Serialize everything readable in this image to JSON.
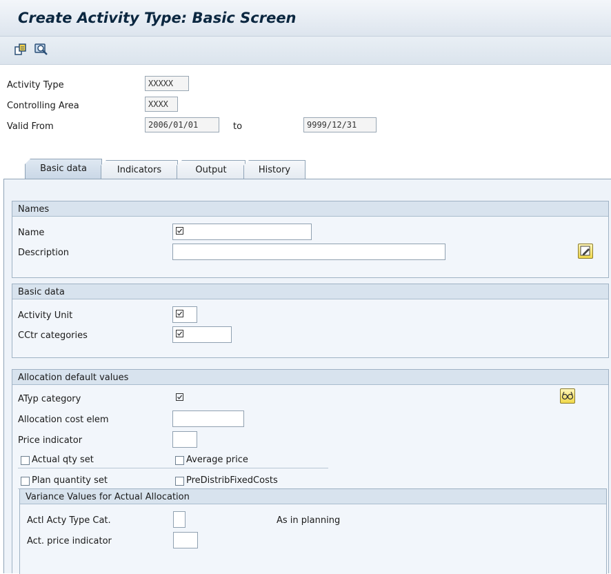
{
  "header": {
    "title": "Create Activity Type: Basic Screen"
  },
  "toolbar": {
    "icons": [
      "copy-icon",
      "display-icon"
    ]
  },
  "top_fields": {
    "activity_type": {
      "label": "Activity Type",
      "value": "XXXXX"
    },
    "controlling_area": {
      "label": "Controlling Area",
      "value": "XXXX"
    },
    "valid_from": {
      "label": "Valid From",
      "value": "2006/01/01",
      "to_label": "to",
      "to_value": "9999/12/31"
    }
  },
  "tabs": [
    {
      "label": "Basic data",
      "active": true
    },
    {
      "label": "Indicators",
      "active": false
    },
    {
      "label": "Output",
      "active": false
    },
    {
      "label": "History",
      "active": false
    }
  ],
  "names": {
    "title": "Names",
    "name_label": "Name",
    "description_label": "Description"
  },
  "basic": {
    "title": "Basic data",
    "activity_unit_label": "Activity Unit",
    "cctr_label": "CCtr categories"
  },
  "alloc": {
    "title": "Allocation default values",
    "atyp_label": "ATyp category",
    "cost_elem_label": "Allocation cost elem",
    "price_ind_label": "Price indicator",
    "actual_qty_label": "Actual qty set",
    "average_price_label": "Average price",
    "plan_qty_label": "Plan quantity set",
    "predistrib_label": "PreDistribFixedCosts"
  },
  "variance": {
    "title": "Variance Values for Actual Allocation",
    "actl_label": "Actl Acty Type Cat.",
    "as_in_planning": "As in planning",
    "act_price_label": "Act. price indicator"
  },
  "colors": {
    "title_bar": "#dde5ee",
    "group_header": "#d8e3ee",
    "accent": "#0b2740"
  }
}
